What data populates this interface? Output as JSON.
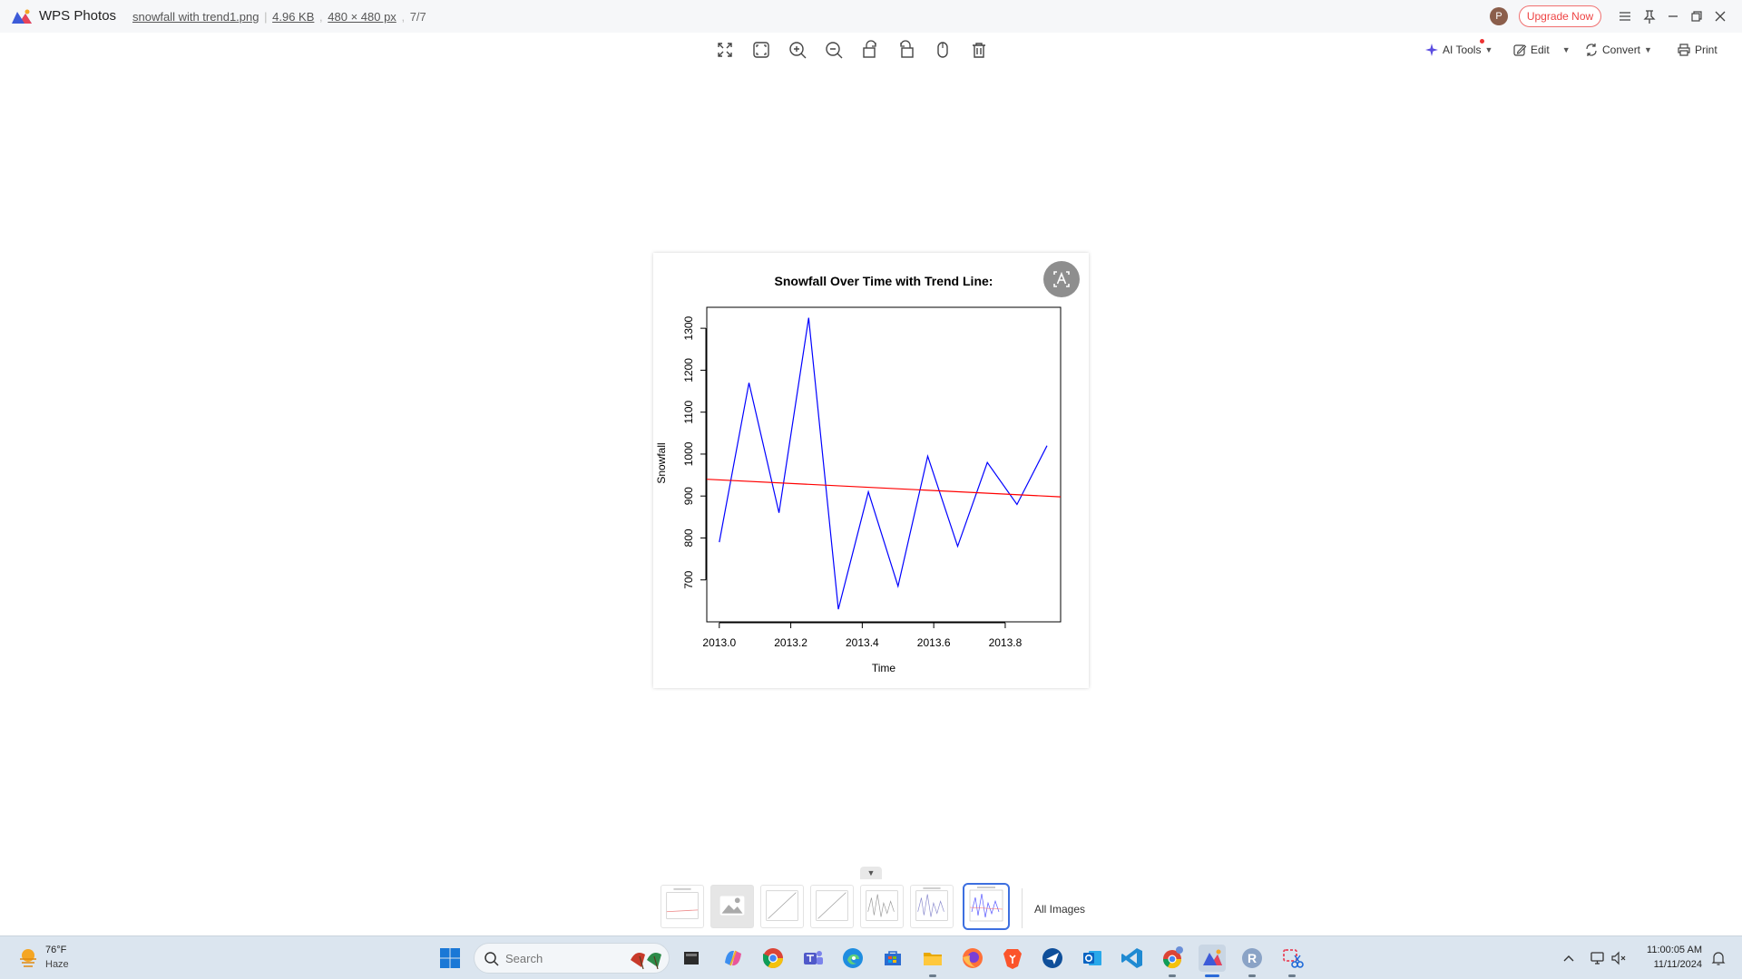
{
  "titlebar": {
    "app_name": "WPS Photos",
    "file_name": "snowfall with trend1.png",
    "file_size": "4.96 KB",
    "dimensions": "480 × 480 px",
    "position": "7/7",
    "avatar_initial": "P",
    "upgrade_label": "Upgrade Now"
  },
  "toolbar": {
    "tools": [
      "fullscreen-icon",
      "fit-window-icon",
      "zoom-in-icon",
      "zoom-out-icon",
      "rotate-left-icon",
      "rotate-right-icon",
      "hand-icon",
      "delete-icon"
    ],
    "ai_tools_label": "AI Tools",
    "edit_label": "Edit",
    "convert_label": "Convert",
    "print_label": "Print"
  },
  "chart_data": {
    "type": "line",
    "title": "Snowfall Over Time with Trend Line:",
    "xlabel": "Time",
    "ylabel": "Snowfall",
    "x_ticks": [
      "2013.0",
      "2013.2",
      "2013.4",
      "2013.6",
      "2013.8"
    ],
    "y_ticks": [
      "700",
      "800",
      "900",
      "1000",
      "1100",
      "1200",
      "1300"
    ],
    "xlim": [
      2012.965,
      2013.955
    ],
    "ylim": [
      600,
      1350
    ],
    "grid": false,
    "series": [
      {
        "color": "#0000ff",
        "x": [
          2013.0,
          2013.083,
          2013.167,
          2013.25,
          2013.333,
          2013.417,
          2013.5,
          2013.583,
          2013.667,
          2013.75,
          2013.833,
          2013.917
        ],
        "y": [
          790,
          1170,
          860,
          1325,
          630,
          910,
          685,
          995,
          780,
          980,
          880,
          1020
        ]
      },
      {
        "color": "#ff0000",
        "x": [
          2012.965,
          2013.955
        ],
        "y": [
          940,
          898
        ]
      }
    ]
  },
  "thumbnail_strip": {
    "count": 7,
    "active_index": 6,
    "all_images_label": "All Images"
  },
  "taskbar": {
    "weather_temp": "76°F",
    "weather_condition": "Haze",
    "search_placeholder": "Search",
    "apps": [
      "file-explorer-dark-icon",
      "copilot-icon",
      "chrome-icon",
      "teams-icon",
      "edge-icon",
      "store-icon",
      "folder-icon",
      "firefox-icon",
      "brave-icon",
      "send-icon",
      "outlook-icon",
      "vscode-icon",
      "chrome-profile-icon",
      "wps-photos-icon",
      "r-icon",
      "snipping-tool-icon"
    ],
    "clock_time": "11:00:05 AM",
    "clock_date": "11/11/2024"
  },
  "colors": {
    "accent": "#3d6fe0",
    "upgrade_red": "#e44444",
    "taskbar_bg": "#dbe5ef"
  }
}
